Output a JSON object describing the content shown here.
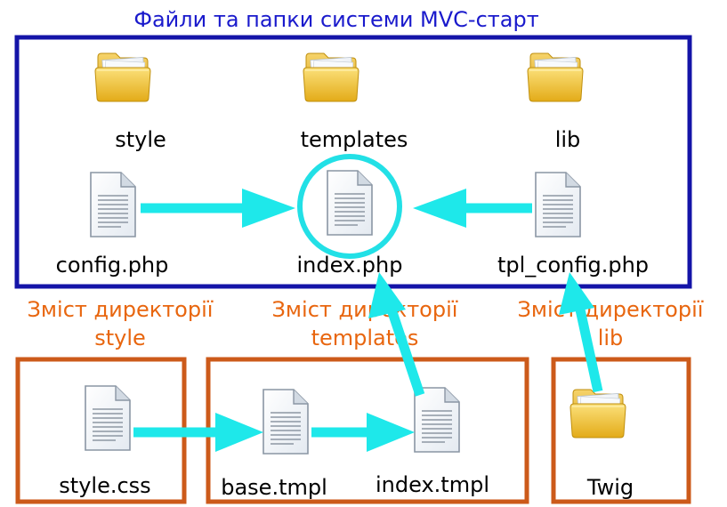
{
  "title": "Файли та папки системи MVC-старт",
  "mvc_box": {
    "folders": [
      {
        "id": "style",
        "label": "style"
      },
      {
        "id": "templates",
        "label": "templates"
      },
      {
        "id": "lib",
        "label": "lib"
      }
    ],
    "files": [
      {
        "id": "config",
        "label": "config.php"
      },
      {
        "id": "index",
        "label": "index.php"
      },
      {
        "id": "tpl_config",
        "label": "tpl_config.php"
      }
    ]
  },
  "sections": [
    {
      "id": "style",
      "title_line1": "Зміст директорії",
      "title_line2": "style",
      "items": [
        {
          "label": "style.css"
        }
      ]
    },
    {
      "id": "templates",
      "title_line1": "Зміст директорії",
      "title_line2": "templates",
      "items": [
        {
          "label": "base.tmpl"
        },
        {
          "label": "index.tmpl"
        }
      ]
    },
    {
      "id": "lib",
      "title_line1": "Зміст директорії",
      "title_line2": "lib",
      "items": [
        {
          "label": "Twig"
        }
      ]
    }
  ],
  "colors": {
    "main_border": "#1414a8",
    "title_blue": "#1a1acc",
    "section_border": "#cc5a1a",
    "section_title": "#e8660f",
    "arrow": "#1ee8ea",
    "highlight": "#22e0e6",
    "folder_fill": "#f2c230",
    "folder_edge": "#c79a12",
    "file_fill": "#f2f6fa"
  },
  "icons": {
    "folder": "folder-icon",
    "file": "document-icon"
  }
}
